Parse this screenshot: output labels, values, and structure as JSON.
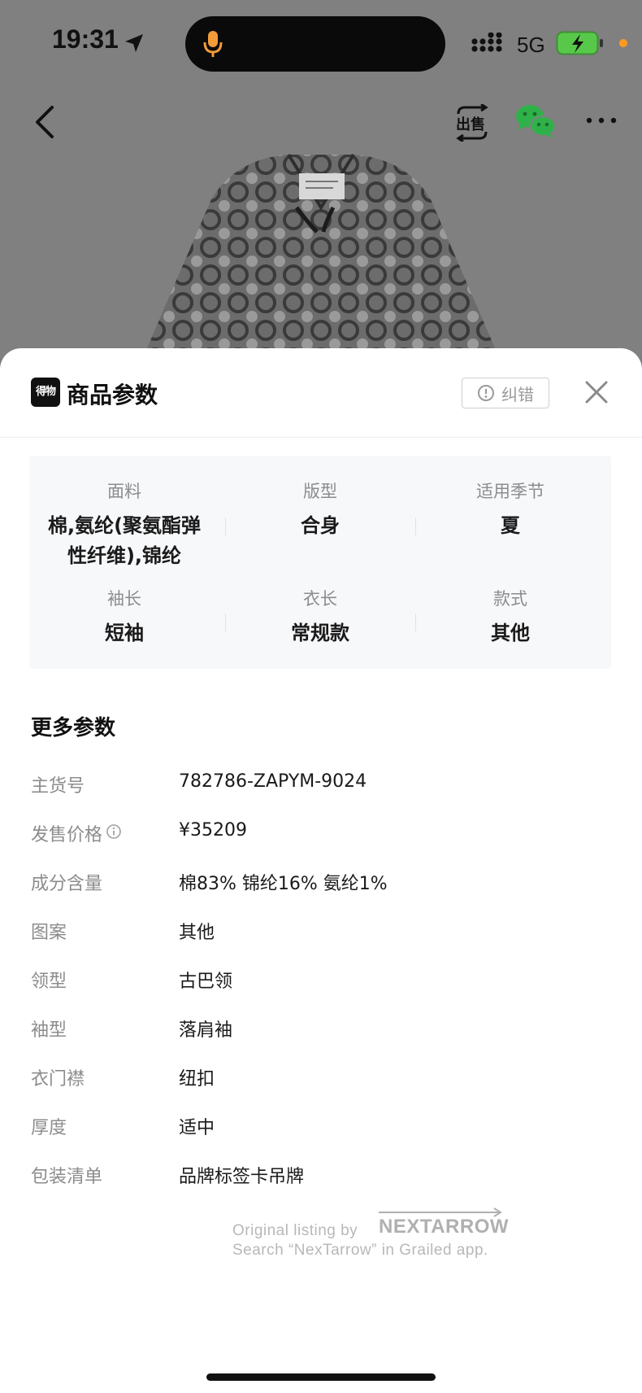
{
  "status_bar": {
    "time": "19:31",
    "network": "5G"
  },
  "sheet": {
    "brand_logo_text": "得物",
    "title": "商品参数",
    "correct_label": "纠错"
  },
  "params": [
    {
      "label": "面料",
      "value": "棉,氨纶(聚氨酯弹性纤维),锦纶"
    },
    {
      "label": "版型",
      "value": "合身"
    },
    {
      "label": "适用季节",
      "value": "夏"
    },
    {
      "label": "袖长",
      "value": "短袖"
    },
    {
      "label": "衣长",
      "value": "常规款"
    },
    {
      "label": "款式",
      "value": "其他"
    }
  ],
  "more_params": {
    "title": "更多参数",
    "rows": [
      {
        "label": "主货号",
        "value": "782786-ZAPYM-9024"
      },
      {
        "label": "发售价格",
        "value": "¥35209"
      },
      {
        "label": "成分含量",
        "value": "棉83% 锦纶16% 氨纶1%"
      },
      {
        "label": "图案",
        "value": "其他"
      },
      {
        "label": "领型",
        "value": "古巴领"
      },
      {
        "label": "袖型",
        "value": "落肩袖"
      },
      {
        "label": "衣门襟",
        "value": "纽扣"
      },
      {
        "label": "厚度",
        "value": "适中"
      },
      {
        "label": "包装清单",
        "value": "品牌标签卡吊牌"
      }
    ]
  },
  "watermark": {
    "line1": "Original listing by",
    "logo": "NEXTARROW",
    "line2": "Search “NexTarrow” in Grailed app."
  },
  "icons": {
    "location": "location-arrow-icon",
    "mic": "microphone-icon",
    "signal": "signal-icon",
    "battery": "battery-charging-icon",
    "back": "chevron-left-icon",
    "sell": "sell-icon",
    "wechat": "wechat-icon",
    "more": "more-dots-icon",
    "info": "info-circle-icon",
    "close": "close-icon",
    "alert": "alert-circle-icon"
  },
  "colors": {
    "accent_mic": "#f29b38",
    "battery_green": "#58c84a",
    "wechat_green": "#2fb14a"
  }
}
